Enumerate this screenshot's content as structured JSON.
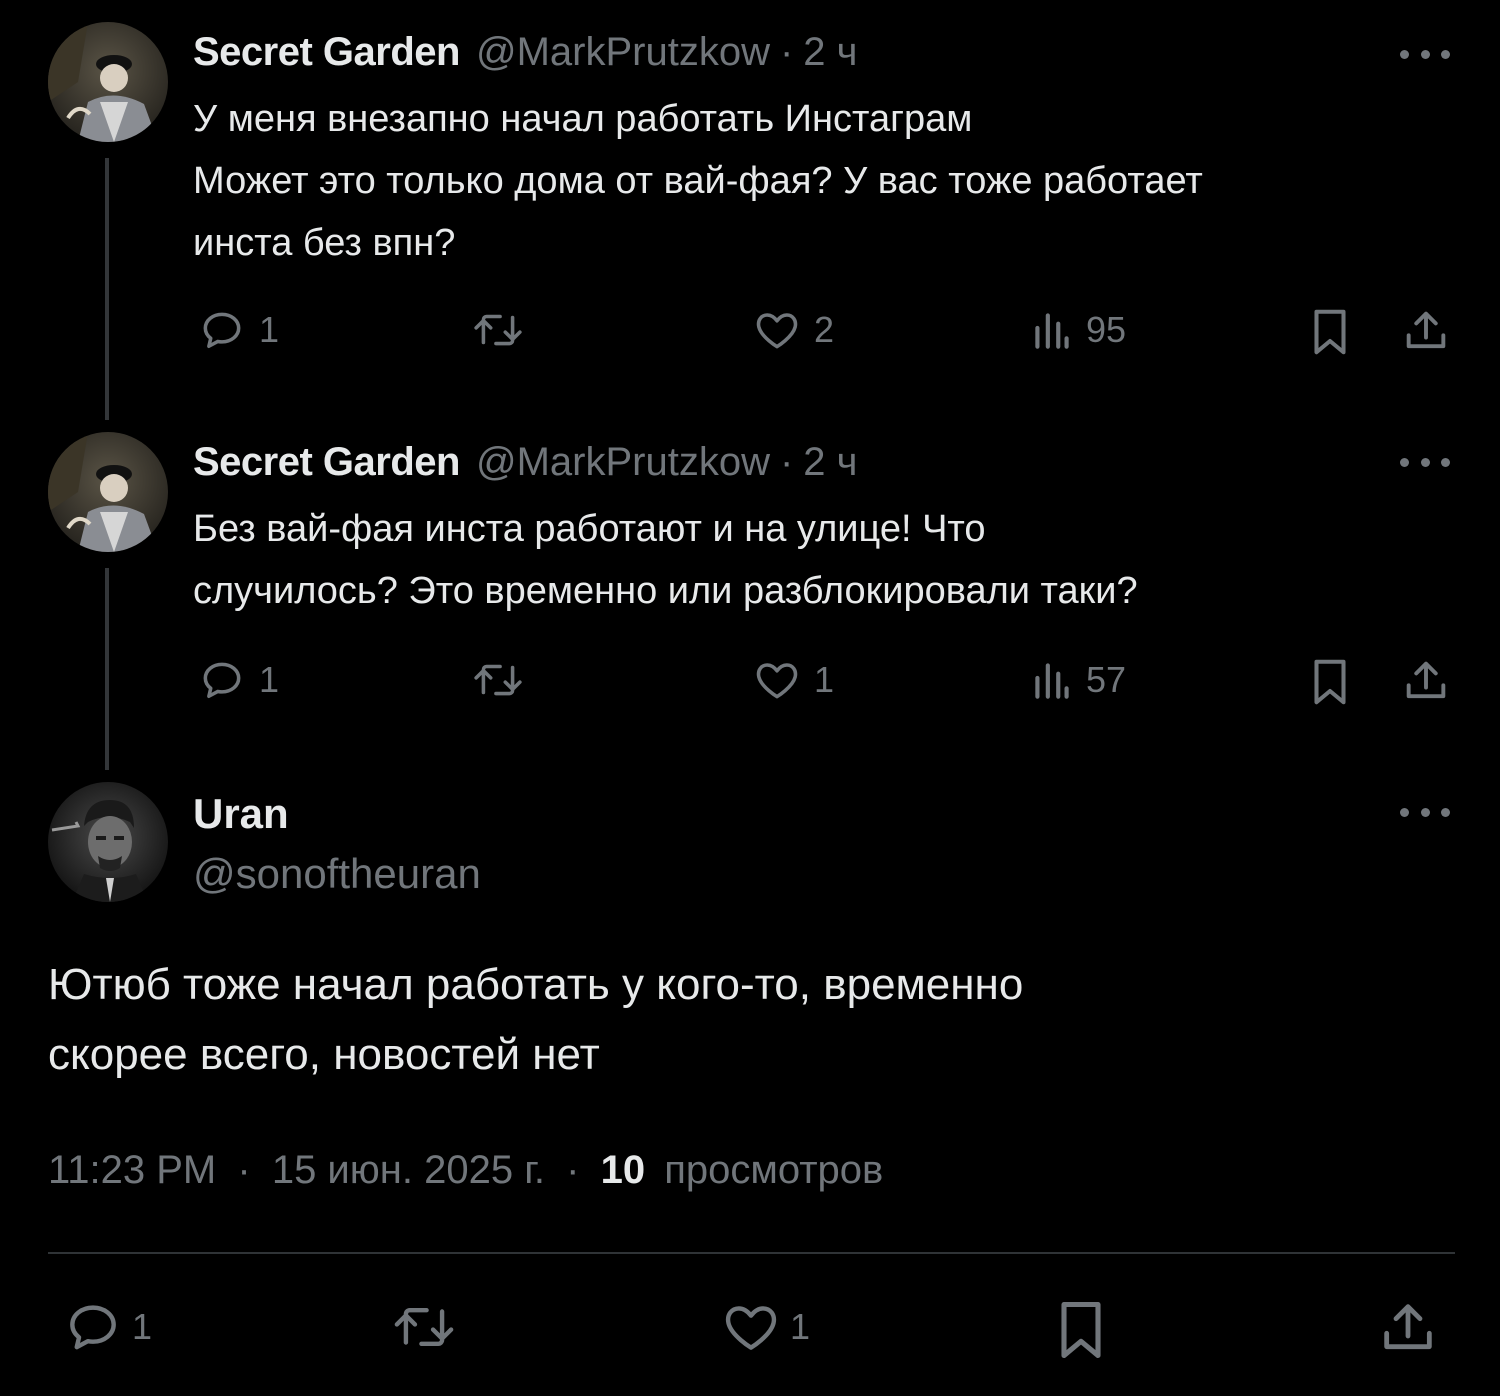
{
  "thread": [
    {
      "name": "Secret Garden",
      "handle": "@MarkPrutzkow",
      "separator": "·",
      "time": "2 ч",
      "text": "У меня внезапно начал работать Инстаграм\nМожет это только дома от вай-фая? У вас тоже работает\nинста без впн?",
      "replies": "1",
      "retweets": "",
      "likes": "2",
      "views": "95"
    },
    {
      "name": "Secret Garden",
      "handle": "@MarkPrutzkow",
      "separator": "·",
      "time": "2 ч",
      "text": "Без вай-фая                  инста работают и на улице! Что\nслучилось? Это временно или разблокировали таки?",
      "replies": "1",
      "retweets": "",
      "likes": "1",
      "views": "57"
    }
  ],
  "main": {
    "name": "Uran",
    "handle": "@sonoftheuran",
    "text": "Ютюб тоже начал работать                       у кого-то, временно\nскорее всего, новостей нет",
    "time": "11:23 PM",
    "date": "15 июн. 2025 г.",
    "separator": "·",
    "views_count": "10",
    "views_label": "просмотров",
    "replies": "1",
    "retweets": "",
    "likes": "1"
  },
  "icons": {
    "reply": "reply-icon",
    "retweet": "retweet-icon",
    "like": "heart-icon",
    "views": "views-icon",
    "bookmark": "bookmark-icon",
    "share": "share-icon",
    "more": "more-icon"
  },
  "colors": {
    "background": "#000000",
    "text": "#e7e9ea",
    "muted": "#71767b",
    "divider": "#2f3336"
  }
}
